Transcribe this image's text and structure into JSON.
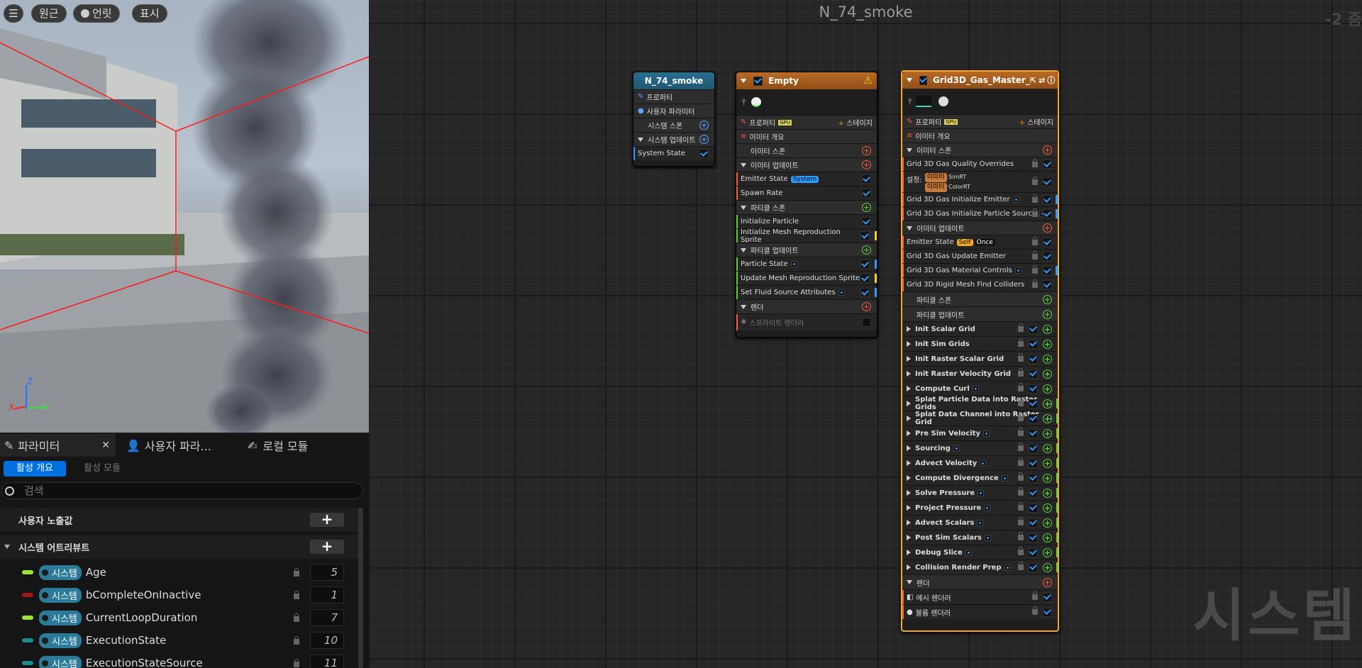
{
  "viewport": {
    "buttons": [
      "원근",
      "언릿",
      "표시"
    ],
    "axis": {
      "z": "Z",
      "x": "X",
      "y": "Y"
    }
  },
  "graph": {
    "title": "N_74_smoke",
    "zoom": "-2 줌",
    "watermark": "시스템"
  },
  "system_node": {
    "title": "N_74_smoke",
    "rows": [
      "프로퍼티",
      "사용자 파라미터",
      "시스템 스폰",
      "시스템 업데이트",
      "System State"
    ]
  },
  "empty_node": {
    "title": "Empty",
    "properties": "프로퍼티",
    "stage": "스테이지",
    "summary": "이미터 개요",
    "emitter_spawn": "이미터 스폰",
    "emitter_update": "이미터 업데이트",
    "emitter_state": "Emitter State",
    "emitter_state_tag": "System",
    "spawn_rate": "Spawn Rate",
    "particle_spawn": "파티클 스폰",
    "init_particle": "Initialize Particle",
    "init_mesh": "Initialize Mesh Reproduction Sprite",
    "particle_update": "파티클 업데이트",
    "particle_state": "Particle State",
    "update_mesh": "Update Mesh Reproduction Sprite",
    "set_fluid": "Set Fluid Source Attributes",
    "render": "렌더",
    "sprite_renderer": "스프라이트 렌더러"
  },
  "grid_node": {
    "title": "Grid3D_Gas_Master_",
    "properties": "프로퍼티",
    "stage": "스테이지",
    "summary": "이미터 개요",
    "emitter_spawn": "이미터 스폰",
    "quality": "Grid 3D Gas Quality Overrides",
    "settings": "설정:",
    "tag1": "이미터",
    "simrt": "SimRT",
    "tag2": "이미터",
    "colorrt": "ColorRT",
    "init_emitter": "Grid 3D Gas Initialize Emitter",
    "init_source": "Grid 3D Gas Initialize Particle Source",
    "emitter_update": "이미터 업데이트",
    "emitter_state": "Emitter State",
    "tag_self": "Self",
    "tag_once": "Once",
    "update_emitter": "Grid 3D Gas Update Emitter",
    "material": "Grid 3D Gas Material Controls",
    "rigid": "Grid 3D Rigid Mesh Find Colliders",
    "particle_spawn": "파티클 스폰",
    "particle_update": "파티클 업데이트",
    "stages": [
      "Init Scalar Grid",
      "Init Sim Grids",
      "Init Raster Scalar Grid",
      "Init Raster Velocity Grid",
      "Compute Curl",
      "Splat Particle Data into Raster Grids",
      "Splat Data Channel into Raster Grid",
      "Pre Sim Velocity",
      "Sourcing",
      "Advect Velocity",
      "Compute Divergence",
      "Solve Pressure",
      "Project Pressure",
      "Advect Scalars",
      "Post Sim Scalars",
      "Debug Slice",
      "Collision Render Prep"
    ],
    "render": "렌더",
    "mesh_renderer": "메시 렌더러",
    "volume_renderer": "볼륨 렌더러"
  },
  "panel": {
    "tabs": [
      "파라미터",
      "사용자 파라...",
      "로컬 모듈"
    ],
    "sub_tabs": [
      "활성 개요",
      "활성 모듈"
    ],
    "search_placeholder": "검색",
    "user_exposed": "사용자 노출값",
    "system_attrs": "시스템 어트리뷰트",
    "badge": "시스템",
    "attrs": [
      {
        "name": "Age",
        "value": "5",
        "color": "#9be33a"
      },
      {
        "name": "bCompleteOnInactive",
        "value": "1",
        "color": "#a01818"
      },
      {
        "name": "CurrentLoopDuration",
        "value": "7",
        "color": "#9be33a"
      },
      {
        "name": "ExecutionState",
        "value": "10",
        "color": "#1a8a8a"
      },
      {
        "name": "ExecutionStateSource",
        "value": "11",
        "color": "#1a8a8a"
      }
    ]
  }
}
